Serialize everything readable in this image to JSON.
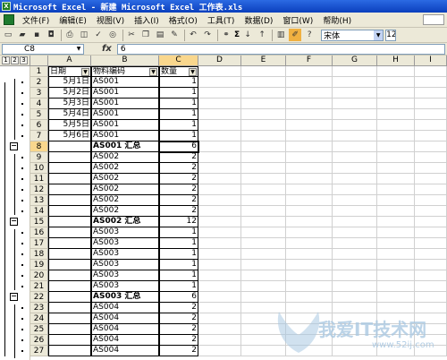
{
  "window": {
    "title": "Microsoft Excel - 新建 Microsoft Excel 工作表.xls",
    "app_icon_letter": "X"
  },
  "menu": {
    "items": [
      "文件(F)",
      "编辑(E)",
      "视图(V)",
      "插入(I)",
      "格式(O)",
      "工具(T)",
      "数据(D)",
      "窗口(W)",
      "帮助(H)"
    ]
  },
  "toolbar": {
    "sum_symbol": "Σ",
    "font_name": "宋体",
    "font_size": "12"
  },
  "formula_bar": {
    "name_box": "C8",
    "fx_label": "fx",
    "value": "6"
  },
  "outline": {
    "levels": [
      "1",
      "2",
      "3"
    ],
    "collapse_symbol": "−"
  },
  "columns": [
    "A",
    "B",
    "C",
    "D",
    "E",
    "F",
    "G",
    "H",
    "I"
  ],
  "active_cell": {
    "column": "C",
    "row": "8"
  },
  "header_row": {
    "row": "1",
    "a": "日期",
    "b": "物料编码",
    "c": "数量"
  },
  "rows": [
    {
      "row": "2",
      "a": "5月1日",
      "b": "AS001",
      "c": "1",
      "bold": false
    },
    {
      "row": "3",
      "a": "5月2日",
      "b": "AS001",
      "c": "1",
      "bold": false
    },
    {
      "row": "4",
      "a": "5月3日",
      "b": "AS001",
      "c": "1",
      "bold": false
    },
    {
      "row": "5",
      "a": "5月4日",
      "b": "AS001",
      "c": "1",
      "bold": false
    },
    {
      "row": "6",
      "a": "5月5日",
      "b": "AS001",
      "c": "1",
      "bold": false
    },
    {
      "row": "7",
      "a": "5月6日",
      "b": "AS001",
      "c": "1",
      "bold": false
    },
    {
      "row": "8",
      "a": "",
      "b": "AS001 汇总",
      "c": "6",
      "bold": true
    },
    {
      "row": "9",
      "a": "",
      "b": "AS002",
      "c": "2",
      "bold": false
    },
    {
      "row": "10",
      "a": "",
      "b": "AS002",
      "c": "2",
      "bold": false
    },
    {
      "row": "11",
      "a": "",
      "b": "AS002",
      "c": "2",
      "bold": false
    },
    {
      "row": "12",
      "a": "",
      "b": "AS002",
      "c": "2",
      "bold": false
    },
    {
      "row": "13",
      "a": "",
      "b": "AS002",
      "c": "2",
      "bold": false
    },
    {
      "row": "14",
      "a": "",
      "b": "AS002",
      "c": "2",
      "bold": false
    },
    {
      "row": "15",
      "a": "",
      "b": "AS002 汇总",
      "c": "12",
      "bold": true
    },
    {
      "row": "16",
      "a": "",
      "b": "AS003",
      "c": "1",
      "bold": false
    },
    {
      "row": "17",
      "a": "",
      "b": "AS003",
      "c": "1",
      "bold": false
    },
    {
      "row": "18",
      "a": "",
      "b": "AS003",
      "c": "1",
      "bold": false
    },
    {
      "row": "19",
      "a": "",
      "b": "AS003",
      "c": "1",
      "bold": false
    },
    {
      "row": "20",
      "a": "",
      "b": "AS003",
      "c": "1",
      "bold": false
    },
    {
      "row": "21",
      "a": "",
      "b": "AS003",
      "c": "1",
      "bold": false
    },
    {
      "row": "22",
      "a": "",
      "b": "AS003 汇总",
      "c": "6",
      "bold": true
    },
    {
      "row": "23",
      "a": "",
      "b": "AS004",
      "c": "2",
      "bold": false
    },
    {
      "row": "24",
      "a": "",
      "b": "AS004",
      "c": "2",
      "bold": false
    },
    {
      "row": "25",
      "a": "",
      "b": "AS004",
      "c": "2",
      "bold": false
    },
    {
      "row": "26",
      "a": "",
      "b": "AS004",
      "c": "2",
      "bold": false
    },
    {
      "row": "27",
      "a": "",
      "b": "AS004",
      "c": "2",
      "bold": false
    }
  ],
  "watermark": {
    "text": "我爱IT技术网",
    "url": "www.52ij.com"
  }
}
